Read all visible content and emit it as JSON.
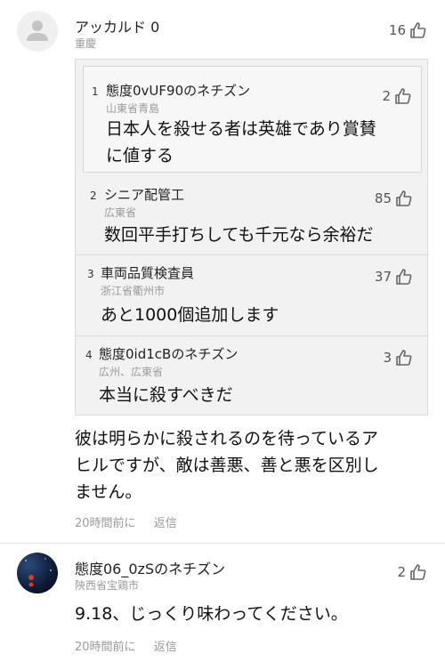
{
  "comment1": {
    "username": "アッカルド 0",
    "location": "重慶",
    "likes": "16",
    "replies": [
      {
        "index": "1",
        "username": "態度0vUF90のネチズン",
        "location": "山東省青島",
        "likes": "2",
        "text_line1": "日本人を殺せる者は英雄であり賞賛",
        "text_line2": "に値する"
      },
      {
        "index": "2",
        "username": "シニア配管工",
        "location": "広東省",
        "likes": "85",
        "text_line1": "数回平手打ちしても千元なら余裕だ"
      },
      {
        "index": "3",
        "username": "車両品質検査員",
        "location": "浙江省衢州市",
        "likes": "37",
        "text_line1": "あと1000個追加します"
      },
      {
        "index": "4",
        "username": "態度0id1cBのネチズン",
        "location": "広州、広東省",
        "likes": "3",
        "text_line1": "本当に殺すべきだ"
      }
    ],
    "text_line1": "彼は明らかに殺されるのを待っているア",
    "text_line2": "ヒルですが、敵は善悪、善と悪を区別し",
    "text_line3": "ません。",
    "time": "20時間前に",
    "reply_label": "返信"
  },
  "comment2": {
    "username": "態度06_0zSのネチズン",
    "location": "陝西省宝鶏市",
    "likes": "2",
    "text_line1": "9.18、じっくり味わってください。",
    "time": "20時間前に",
    "reply_label": "返信"
  },
  "icons": {
    "avatar_default": "person-icon",
    "like": "thumbs-up-icon"
  }
}
